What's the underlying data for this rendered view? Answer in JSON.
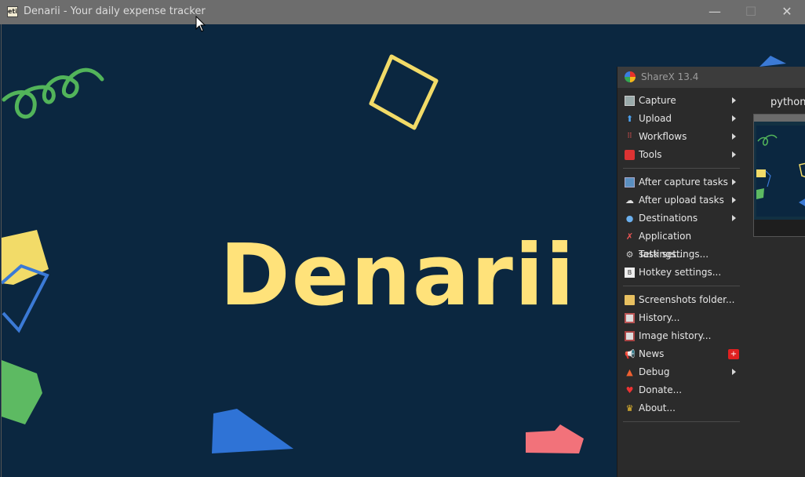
{
  "window": {
    "icon_text": "eti",
    "title": "Denarii - Your daily expense tracker",
    "minimize_glyph": "—",
    "maximize_glyph": "☐",
    "close_glyph": "✕"
  },
  "app": {
    "logo_text": "Denarii",
    "background": "#0b2740",
    "logo_color": "#ffe27a"
  },
  "sharex": {
    "title": "ShareX 13.4",
    "right_label": "python_",
    "menu": [
      {
        "label": "Capture",
        "icon": "capture-icon",
        "submenu": true
      },
      {
        "label": "Upload",
        "icon": "upload-arrow-icon",
        "submenu": true
      },
      {
        "label": "Workflows",
        "icon": "workflows-grid-icon",
        "submenu": true
      },
      {
        "label": "Tools",
        "icon": "toolbox-icon",
        "submenu": true
      },
      {
        "label": "After capture tasks",
        "icon": "after-capture-icon",
        "submenu": true
      },
      {
        "label": "After upload tasks",
        "icon": "cloud-upload-icon",
        "submenu": true
      },
      {
        "label": "Destinations",
        "icon": "destinations-icon",
        "submenu": true
      },
      {
        "label": "Application settings...",
        "icon": "wrench-screwdriver-icon",
        "submenu": false
      },
      {
        "label": "Task settings...",
        "icon": "gear-icon",
        "submenu": false
      },
      {
        "label": "Hotkey settings...",
        "icon": "keyboard-key-icon",
        "submenu": false
      },
      {
        "label": "Screenshots folder...",
        "icon": "folder-icon",
        "submenu": false
      },
      {
        "label": "History...",
        "icon": "history-list-icon",
        "submenu": false
      },
      {
        "label": "Image history...",
        "icon": "image-history-icon",
        "submenu": false
      },
      {
        "label": "News",
        "icon": "megaphone-icon",
        "submenu": false,
        "badge": "+"
      },
      {
        "label": "Debug",
        "icon": "traffic-cone-icon",
        "submenu": true
      },
      {
        "label": "Donate...",
        "icon": "heart-icon",
        "submenu": false
      },
      {
        "label": "About...",
        "icon": "crown-icon",
        "submenu": false
      }
    ]
  }
}
